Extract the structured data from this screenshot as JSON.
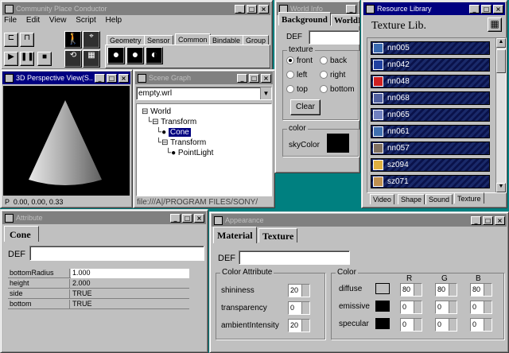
{
  "conductor": {
    "title": "Community Place Conductor",
    "menu": [
      "File",
      "Edit",
      "View",
      "Script",
      "Help"
    ],
    "tabs": [
      "Geometry",
      "Sensor",
      "Common",
      "Bindable",
      "Group"
    ],
    "active_tab": "Common"
  },
  "perspective": {
    "title": "3D Perspective View(S...",
    "status": "P  0.00, 0.00, 0.33"
  },
  "scene": {
    "title": "Scene Graph",
    "file": "empty.wrl",
    "tree": [
      "World",
      "Transform",
      "Cone",
      "Transform",
      "PointLight"
    ],
    "path": "file:///A|/PROGRAM FILES/SONY/"
  },
  "worldinfo": {
    "title": "World Info",
    "tabs": [
      "Background",
      "WorldInfo"
    ],
    "def_label": "DEF",
    "texture_label": "texture",
    "radios": [
      "front",
      "back",
      "left",
      "right",
      "top",
      "bottom"
    ],
    "clear": "Clear",
    "color_label": "color",
    "sky_label": "skyColor"
  },
  "library": {
    "title": "Resource Library",
    "heading": "Texture Lib.",
    "items": [
      {
        "name": "nn005",
        "color": "#3a6ab0"
      },
      {
        "name": "nn042",
        "color": "#2040a0"
      },
      {
        "name": "nn048",
        "color": "#d02020"
      },
      {
        "name": "nn068",
        "color": "#5060a0"
      },
      {
        "name": "nn065",
        "color": "#7080c0"
      },
      {
        "name": "nn061",
        "color": "#4070b0"
      },
      {
        "name": "nn057",
        "color": "#807060"
      },
      {
        "name": "sz094",
        "color": "#e0b040"
      },
      {
        "name": "sz071",
        "color": "#c09050"
      }
    ],
    "tabs": [
      "Video",
      "Shape",
      "Sound",
      "Texture"
    ]
  },
  "attribute": {
    "title": "Attribute",
    "tab": "Cone",
    "def_label": "DEF",
    "rows": [
      {
        "k": "bottomRadius",
        "v": "1.000"
      },
      {
        "k": "height",
        "v": "2.000"
      },
      {
        "k": "side",
        "v": "TRUE"
      },
      {
        "k": "bottom",
        "v": "TRUE"
      }
    ]
  },
  "appearance": {
    "title": "Appearance",
    "tabs": [
      "Material",
      "Texture"
    ],
    "def_label": "DEF",
    "attr_group": "Color Attribute",
    "attrs": [
      {
        "label": "shininess",
        "value": "20"
      },
      {
        "label": "transparency",
        "value": "0"
      },
      {
        "label": "ambientIntensity",
        "value": "20"
      }
    ],
    "color_group": "Color",
    "rgb_headers": [
      "R",
      "G",
      "B"
    ],
    "colors": [
      {
        "label": "diffuse",
        "swatch": "#c0c0c0",
        "r": "80",
        "g": "80",
        "b": "80"
      },
      {
        "label": "emissive",
        "swatch": "#000000",
        "r": "0",
        "g": "0",
        "b": "0"
      },
      {
        "label": "specular",
        "swatch": "#000000",
        "r": "0",
        "g": "0",
        "b": "0"
      }
    ]
  }
}
